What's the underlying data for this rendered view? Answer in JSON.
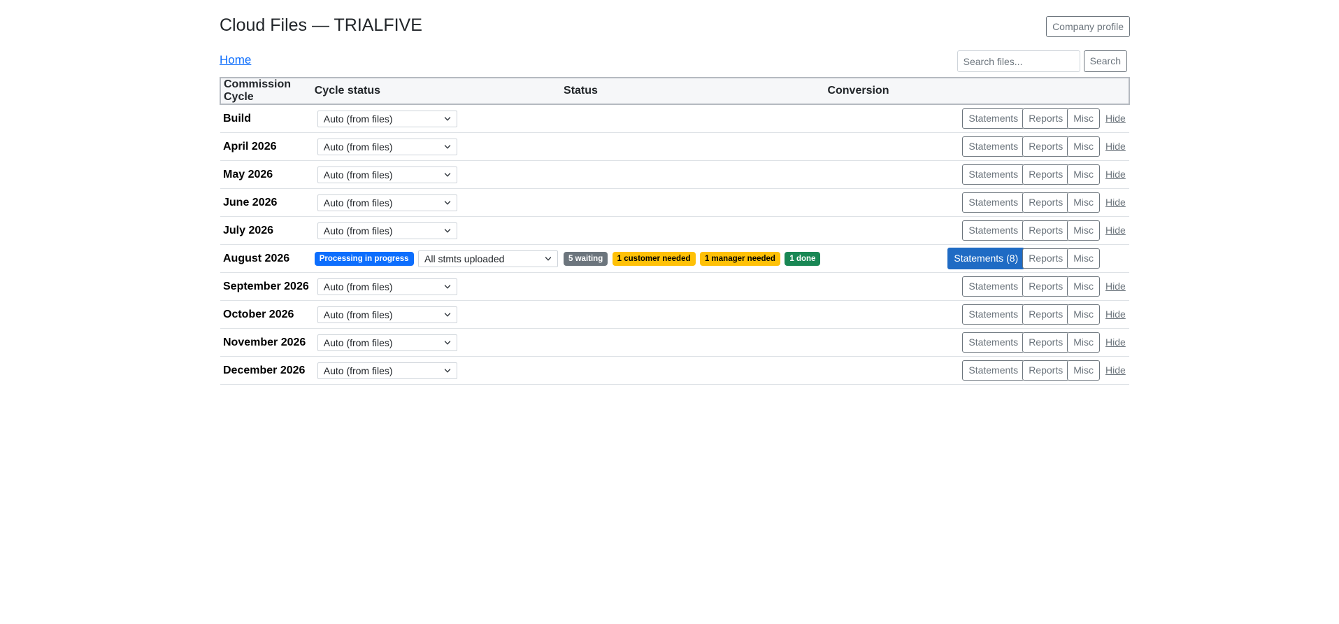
{
  "header": {
    "title": "Cloud Files — TRIALFIVE",
    "company_profile_label": "Company profile"
  },
  "nav": {
    "home_label": "Home",
    "search_placeholder": "Search files...",
    "search_button_label": "Search"
  },
  "table": {
    "columns": [
      "Commission Cycle",
      "Cycle status",
      "Status",
      "Conversion"
    ],
    "action_labels": {
      "statements": "Statements",
      "reports": "Reports",
      "misc": "Misc",
      "hide": "Hide"
    },
    "rows": [
      {
        "name": "Build",
        "cycle_status": "Auto (from files)"
      },
      {
        "name": "April 2026",
        "cycle_status": "Auto (from files)"
      },
      {
        "name": "May 2026",
        "cycle_status": "Auto (from files)"
      },
      {
        "name": "June 2026",
        "cycle_status": "Auto (from files)"
      },
      {
        "name": "July 2026",
        "cycle_status": "Auto (from files)"
      },
      {
        "name": "August 2026",
        "processing_badge": "Processing in progress",
        "cycle_status": "All stmts uploaded",
        "status_badges": [
          "5 waiting",
          "1 customer needed",
          "1 manager needed",
          "1 done"
        ],
        "statements_label": "Statements (8)"
      },
      {
        "name": "September 2026",
        "cycle_status": "Auto (from files)"
      },
      {
        "name": "October 2026",
        "cycle_status": "Auto (from files)"
      },
      {
        "name": "November 2026",
        "cycle_status": "Auto (from files)"
      },
      {
        "name": "December 2026",
        "cycle_status": "Auto (from files)"
      }
    ]
  },
  "colors": {
    "primary": "#0d6efd",
    "statements_active": "#1f6bc4",
    "badge_waiting": "#6c757d",
    "badge_needed": "#ffc107",
    "badge_done": "#198754"
  }
}
